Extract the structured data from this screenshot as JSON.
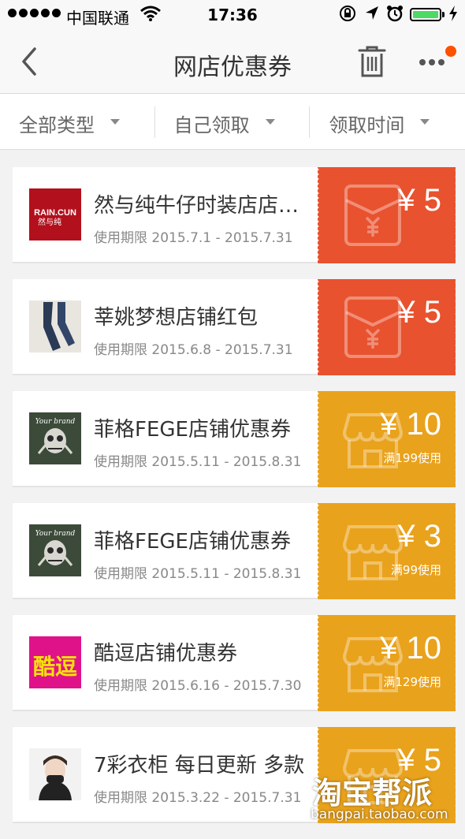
{
  "status_bar": {
    "carrier": "中国联通",
    "time": "17:36",
    "battery_color": "#4cd964"
  },
  "nav": {
    "title": "网店优惠券",
    "back_icon": "chevron-left-icon",
    "trash_icon": "trash-icon",
    "more_icon": "more-dots-icon",
    "badge_color": "#ff5000"
  },
  "filters": [
    {
      "label": "全部类型"
    },
    {
      "label": "自己领取"
    },
    {
      "label": "领取时间"
    }
  ],
  "colors": {
    "red": "#e8522f",
    "gold": "#e9a21c"
  },
  "coupons": [
    {
      "name": "然与纯牛仔时装店店铺红包",
      "period": "使用期限 2015.7.1 - 2015.7.31",
      "amount": "¥ 5",
      "condition": "",
      "style": "red",
      "icon": "red-envelope-icon",
      "logo": "rain-cun-logo",
      "logo_text": "RAIN.CUN",
      "logo_sub": "然与纯"
    },
    {
      "name": "莘姚梦想店铺红包",
      "period": "使用期限 2015.6.8 - 2015.7.31",
      "amount": "¥ 5",
      "condition": "",
      "style": "red",
      "icon": "red-envelope-icon",
      "logo": "jeans-photo"
    },
    {
      "name": "菲格FEGE店铺优惠券",
      "period": "使用期限 2015.5.11 - 2015.8.31",
      "amount": "¥ 10",
      "condition": "满199使用",
      "style": "gold",
      "icon": "shop-icon",
      "logo": "skull-brand-logo",
      "logo_text": "Your brand"
    },
    {
      "name": "菲格FEGE店铺优惠券",
      "period": "使用期限 2015.5.11 - 2015.8.31",
      "amount": "¥ 3",
      "condition": "满99使用",
      "style": "gold",
      "icon": "shop-icon",
      "logo": "skull-brand-logo",
      "logo_text": "Your brand"
    },
    {
      "name": "酷逗店铺优惠券",
      "period": "使用期限 2015.6.16 - 2015.7.30",
      "amount": "¥ 10",
      "condition": "满129使用",
      "style": "gold",
      "icon": "shop-icon",
      "logo": "kudou-logo",
      "logo_text": "酷逗"
    },
    {
      "name": "7彩衣柜 每日更新 多款",
      "period": "使用期限 2015.3.22 - 2015.7.31",
      "amount": "¥ 5",
      "condition": "",
      "style": "gold",
      "icon": "shop-icon",
      "logo": "model-portrait-photo"
    }
  ],
  "watermark": {
    "brand": "淘宝帮派",
    "url": "bangpai.taobao.com"
  }
}
